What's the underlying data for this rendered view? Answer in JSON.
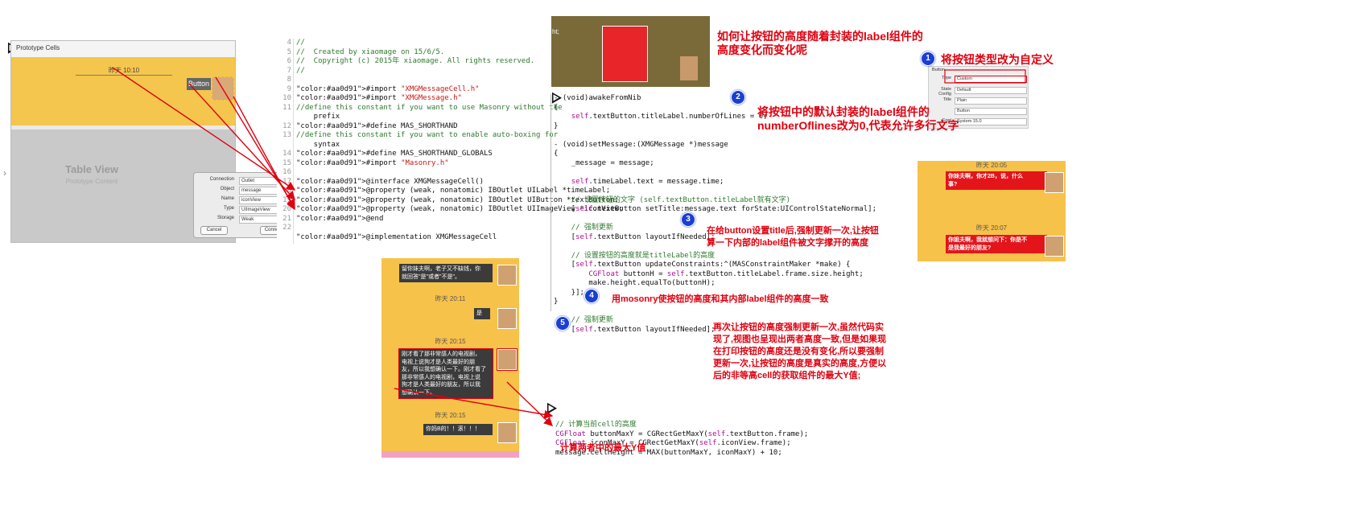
{
  "storyboard": {
    "section_title": "Prototype Cells",
    "time_label": "昨天 10:10",
    "button_label": "Button",
    "table_view_title": "Table View",
    "table_view_subtitle": "Prototype Content"
  },
  "connection_popup": {
    "rows": [
      {
        "key": "Connection",
        "value": "Outlet"
      },
      {
        "key": "Object",
        "value": "message"
      },
      {
        "key": "Name",
        "value": "iconView"
      },
      {
        "key": "Type",
        "value": "UIImageView"
      },
      {
        "key": "Storage",
        "value": "Weak"
      }
    ],
    "cancel_label": "Cancel",
    "connect_label": "Connect"
  },
  "header_code": {
    "line_numbers": [
      "4",
      "5",
      "6",
      "7",
      "8",
      "9",
      "10",
      "11",
      "",
      "12",
      "13",
      "",
      "14",
      "15",
      "16",
      "17",
      "18",
      "19",
      "20",
      "21",
      "22"
    ],
    "lines": [
      "//",
      "//  Created by xiaomage on 15/6/5.",
      "//  Copyright (c) 2015年 xiaomage. All rights reserved.",
      "//",
      "",
      "#import \"XMGMessageCell.h\"",
      "#import \"XMGMessage.h\"",
      "//define this constant if you want to use Masonry without the",
      "    prefix",
      "#define MAS_SHORTHAND",
      "//define this constant if you want to enable auto-boxing for",
      "    syntax",
      "#define MAS_SHORTHAND_GLOBALS",
      "#import \"Masonry.h\"",
      "",
      "@interface XMGMessageCell()",
      "@property (weak, nonatomic) IBOutlet UILabel *timeLabel;",
      "@property (weak, nonatomic) IBOutlet UIButton *textButton;",
      "@property (weak, nonatomic) IBOutlet UIImageView *iconView;",
      "@end",
      "",
      "@implementation XMGMessageCell"
    ]
  },
  "xib_preview": {
    "text": "ht;"
  },
  "title_note": "如何让按钮的高度随着封装的label组件的\n高度变化而变化呢",
  "inspector": {
    "header": "Button",
    "rows": [
      {
        "key": "Type",
        "value": "Custom"
      },
      {
        "key": "State Config",
        "value": "Default"
      },
      {
        "key": "Title",
        "value": "Plain"
      },
      {
        "key": "",
        "value": "Button"
      },
      {
        "key": "Font",
        "value": "System 15.0"
      }
    ]
  },
  "steps": [
    {
      "num": "1",
      "text": "将按钮类型改为自定义"
    },
    {
      "num": "2",
      "text": "将按钮中的默认封装的label组件的\nnumberOflines改为0,代表允许多行文字"
    },
    {
      "num": "3",
      "text": "在给button设置title后,强制更新一次,让按钮\n算一下内部的label组件被文字撑开的高度"
    },
    {
      "num": "4",
      "text": "用mosonry使按钮的高度和其内部label组件的高度一致"
    },
    {
      "num": "5",
      "text": "再次让按钮的高度强制更新一次,虽然代码实\n现了,视图也呈现出两者高度一致,但是如果现\n在打印按钮的高度还是没有变化,所以要强制\n更新一次,让按钮的高度是真实的高度,方便以\n后的非等高cell的获取组件的最大Y值;"
    }
  ],
  "impl_code": {
    "lines": [
      "- (void)awakeFromNib",
      "{",
      "    self.textButton.titleLabel.numberOfLines = 0;",
      "}",
      "",
      "- (void)setMessage:(XMGMessage *)message",
      "{",
      "    _message = message;",
      "",
      "    self.timeLabel.text = message.time;",
      "",
      "    // 设置按钮的文字 (self.textButton.titleLabel就有文字)",
      "    [self.textButton setTitle:message.text forState:UIControlStateNormal];",
      "",
      "    // 强制更新",
      "    [self.textButton layoutIfNeeded];",
      "",
      "    // 设置按钮的高度就是titleLabel的高度",
      "    [self.textButton updateConstraints:^(MASConstraintMaker *make) {",
      "        CGFloat buttonH = self.textButton.titleLabel.frame.size.height;",
      "        make.height.equalTo(buttonH);",
      "    }];",
      "}",
      "",
      "    // 强制更新",
      "    [self.textButton layoutIfNeeded];"
    ]
  },
  "chat_small": {
    "time1": "昨天 20:05",
    "msg1": "你妹夫啊，你才2B，说，什么\n事?",
    "time2": "昨天 20:07",
    "msg2": "你姐夫啊，我就想问下：你是不\n是我最好的朋友?"
  },
  "chat_large": {
    "msg1": "留你妹夫啊，老子又不缺钱，你\n就回答\"是\"或者\"不是\"。",
    "time1": "昨天 20:11",
    "msg2": "是",
    "time2": "昨天 20:15",
    "msg3": "刚才看了那非常感人的电视剧，\n电视上说狗才是人类最好的朋\n友，所以我想确认一下。刚才看了\n那非常感人的电视剧，电视上说\n狗才是人类最好的朋友，所以我\n想确认一下。",
    "time3": "昨天 20:15",
    "msg4": "你妈B的！！滚！！！"
  },
  "calc_code": {
    "lines": [
      "// 计算当前cell的高度",
      "CGFloat buttonMaxY = CGRectGetMaxY(self.textButton.frame);",
      "CGFloat iconMaxY = CGRectGetMaxY(self.iconView.frame);",
      "message.cellHeight = MAX(buttonMaxY, iconMaxY) + 10;"
    ]
  },
  "calc_note": "计算两者中的最大Y值",
  "colors": {
    "annotation": "#e0000f",
    "badge": "#1a3fd1",
    "chat_bg": "#f7c24a",
    "keyword": "#aa0d91"
  }
}
